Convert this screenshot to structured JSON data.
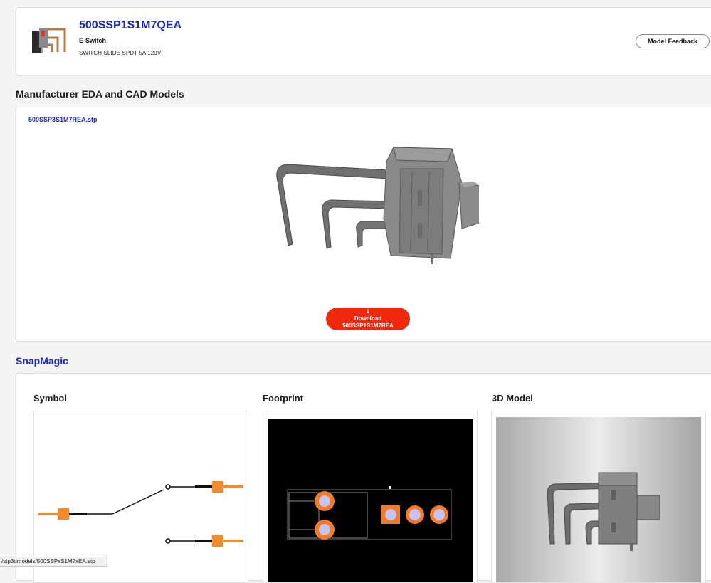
{
  "product": {
    "part_number": "500SSP1S1M7QEA",
    "manufacturer": "E-Switch",
    "description": "SWITCH SLIDE SPDT 5A 120V",
    "feedback_label": "Model Feedback"
  },
  "eda_section": {
    "title": "Manufacturer EDA and CAD Models",
    "file_name": "500SSP3S1M7REA.stp",
    "download_icon": "⤓",
    "download_label": "Download",
    "download_file": "500SSP1S1M7REA"
  },
  "snapmagic": {
    "title": "SnapMagic",
    "panels": {
      "symbol": "Symbol",
      "footprint": "Footprint",
      "model3d": "3D Model"
    }
  },
  "status_bar": {
    "url": "/stp3dmodels/500SSPxS1M7xEA.stp"
  },
  "colors": {
    "link": "#1a2ab5",
    "download_button": "#f0290d",
    "symbol_pin": "#f28a2e",
    "pad_copper": "#f07b2a",
    "pad_hole": "#c7c2f0"
  }
}
